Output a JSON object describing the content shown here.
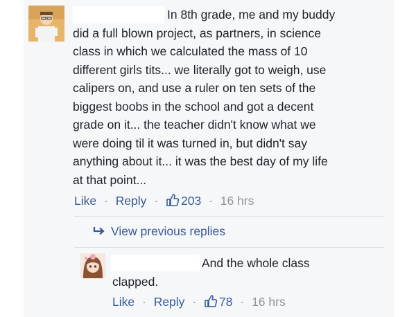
{
  "colors": {
    "link": "#365899",
    "meta": "#90949c",
    "text": "#1d2129",
    "panel": "#f6f7f9"
  },
  "comment": {
    "first_line": "In 8th grade, me and my buddy",
    "lines": [
      "did a full blown project, as partners, in science",
      "class in which we calculated the mass of 10",
      "different girls tits... we literally got to weigh, use",
      "calipers on, and use a ruler on ten sets of the",
      "biggest boobs in the school and got a decent",
      "grade on it... the teacher didn't know what we",
      "were doing til it was turned in, but didn't say",
      "anything about it... it was the best day of my life",
      "at that point..."
    ],
    "actions": {
      "like": "Like",
      "reply": "Reply",
      "likes": "203",
      "time": "16 hrs",
      "sep": "·"
    }
  },
  "view_previous": {
    "label": "View previous replies",
    "icon": "reply-arrow-icon"
  },
  "reply": {
    "first_line": "And the whole class",
    "second_line": "clapped.",
    "actions": {
      "like": "Like",
      "reply": "Reply",
      "likes": "78",
      "time": "16 hrs",
      "sep": "·"
    }
  }
}
